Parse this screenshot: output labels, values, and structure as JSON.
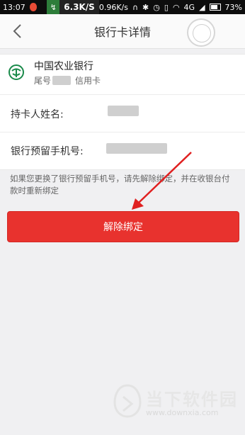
{
  "status_bar": {
    "time": "13:07",
    "speed_box": "↯",
    "speed_big": "6.3K/S",
    "network_speed": "0.96K/s",
    "network": "4G",
    "battery": "73%"
  },
  "nav": {
    "title": "银行卡详情"
  },
  "card": {
    "bank_name": "中国农业银行",
    "tail_label": "尾号",
    "card_type": "信用卡"
  },
  "fields": {
    "holder_label": "持卡人姓名:",
    "phone_label": "银行预留手机号:"
  },
  "notice": "如果您更换了银行预留手机号，请先解除绑定，并在收银台付款时重新绑定",
  "unbind_button": "解除绑定",
  "watermark": {
    "title": "当下软件园",
    "url": "www.downxia.com"
  },
  "colors": {
    "primary": "#e8322e",
    "bank_green": "#1a8a4a",
    "arrow": "#e02020"
  }
}
